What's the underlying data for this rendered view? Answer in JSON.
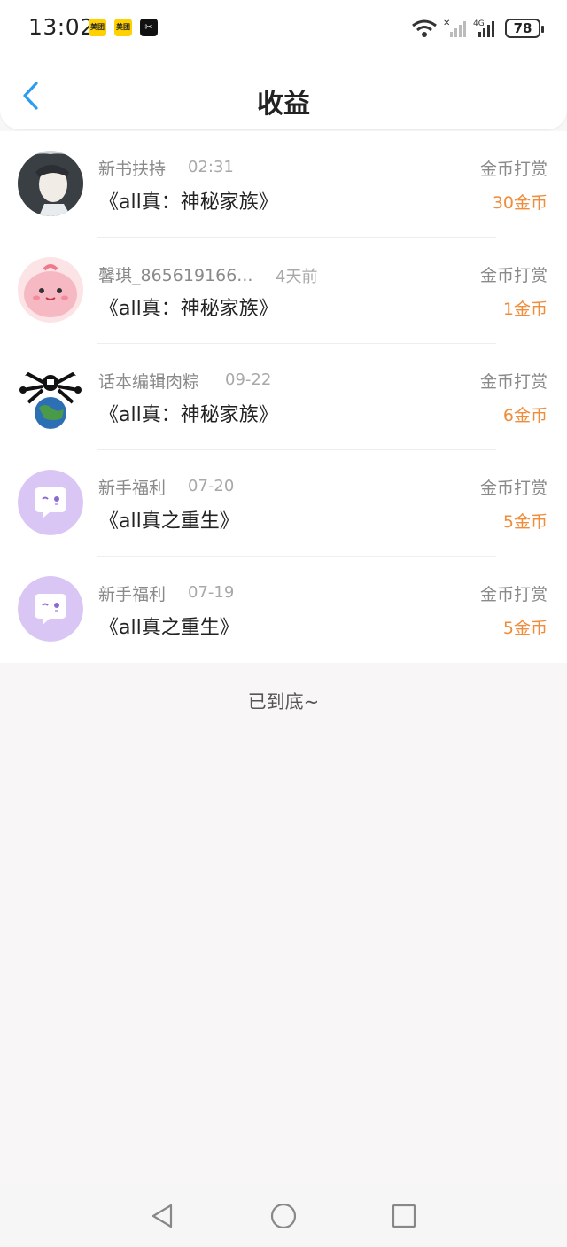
{
  "status_bar": {
    "time": "13:02",
    "apps": [
      "meituan-icon",
      "meituan-icon",
      "capcut-icon"
    ],
    "app_labels": [
      "美团",
      "美团",
      "✂"
    ],
    "battery": "78"
  },
  "header": {
    "title": "收益",
    "back_icon": "chevron-left-icon"
  },
  "colors": {
    "accent": "#2b9cf0",
    "amount": "#f08c3a",
    "background": "#f8f6f7"
  },
  "items": [
    {
      "name": "新书扶持",
      "time": "02:31",
      "book": "《all真：神秘家族》",
      "type": "金币打赏",
      "amount": "30金币",
      "avatar": "anime-character-avatar"
    },
    {
      "name": "馨琪_865619166...",
      "time": "4天前",
      "book": "《all真：神秘家族》",
      "type": "金币打赏",
      "amount": "1金币",
      "avatar": "pink-creature-avatar"
    },
    {
      "name": "话本编辑肉粽",
      "time": "09-22",
      "book": "《all真：神秘家族》",
      "type": "金币打赏",
      "amount": "6金币",
      "avatar": "earth-meme-avatar"
    },
    {
      "name": "新手福利",
      "time": "07-20",
      "book": "《all真之重生》",
      "type": "金币打赏",
      "amount": "5金币",
      "avatar": "chat-bubble-avatar"
    },
    {
      "name": "新手福利",
      "time": "07-19",
      "book": "《all真之重生》",
      "type": "金币打赏",
      "amount": "5金币",
      "avatar": "chat-bubble-avatar"
    }
  ],
  "end_text": "已到底~",
  "nav_bar": [
    "back-triangle-icon",
    "home-circle-icon",
    "recents-square-icon"
  ]
}
